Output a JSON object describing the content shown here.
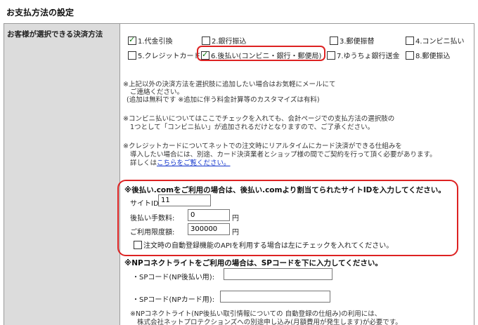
{
  "page_title": "お支払方法の設定",
  "left_label": "お客様が選択できる決済方法",
  "methods": [
    {
      "label": "1.代金引換",
      "checked": true
    },
    {
      "label": "2.銀行振込",
      "checked": false
    },
    {
      "label": "3.郵便振替",
      "checked": false
    },
    {
      "label": "4.コンビニ払い",
      "checked": false
    },
    {
      "label": "5.クレジットカード",
      "checked": false
    },
    {
      "label": "6.後払い(コンビニ・銀行・郵便局)",
      "checked": true
    },
    {
      "label": "7.ゆうちょ銀行送金",
      "checked": false
    },
    {
      "label": "8.郵便振込",
      "checked": false
    }
  ],
  "notes": {
    "n1_l1": "※上記以外の決済方法を選択肢に追加したい場合はお気軽にメールにて",
    "n1_l2": "ご連絡ください。",
    "n1_l3": "(追加は無料です ※追加に伴う料金計算等のカスタマイズは有料)",
    "n2_l1": "※コンビニ払いについてはここでチェックを入れても、会計ページでの支払方法の選択肢の",
    "n2_l2": "1つとして「コンビニ払い」が追加されるだけとなりますので、ご了承ください。",
    "n3_l1": "※クレジットカードについてネットでの注文時にリアルタイムにカード決済ができる仕組みを",
    "n3_l2": "導入したい場合には、別途、カード決済業者とショップ様の間でご契約を行って頂く必要があります。",
    "n3_l3_prefix": "詳しくは",
    "n3_l3_link": "こちらをご覧ください。"
  },
  "atobarai": {
    "heading": "※後払い.comをご利用の場合は、後払い.comより割当てられたサイトIDを入力してください。",
    "site_id_label": "サイトID:",
    "site_id_value": "11",
    "fee_label": "後払い手数料:",
    "fee_value": "0",
    "fee_unit": "円",
    "limit_label": "ご利用限度額:",
    "limit_value": "300000",
    "limit_unit": "円",
    "api_checkbox_label": "注文時の自動登録機能のAPIを利用する場合は左にチェックを入れてください。"
  },
  "np": {
    "heading": "※NPコネクトライトをご利用の場合は、SPコードを下に入力してください。",
    "sp_atobarai_label": "・SPコード(NP後払い用):",
    "sp_atobarai_value": "",
    "sp_card_label": "・SPコード(NPカード用):",
    "sp_card_value": "",
    "footer_l1": "※NPコネクトライト(NP後払い取引情報についての 自動登録の仕組み)の利用には、",
    "footer_l2": "株式会社ネットプロテクションズへの別途申し込み(月額費用が発生します)が必要です。"
  },
  "colors": {
    "highlight": "#dd2222",
    "label_bg": "#dcdcdc",
    "link": "#1133cc"
  }
}
